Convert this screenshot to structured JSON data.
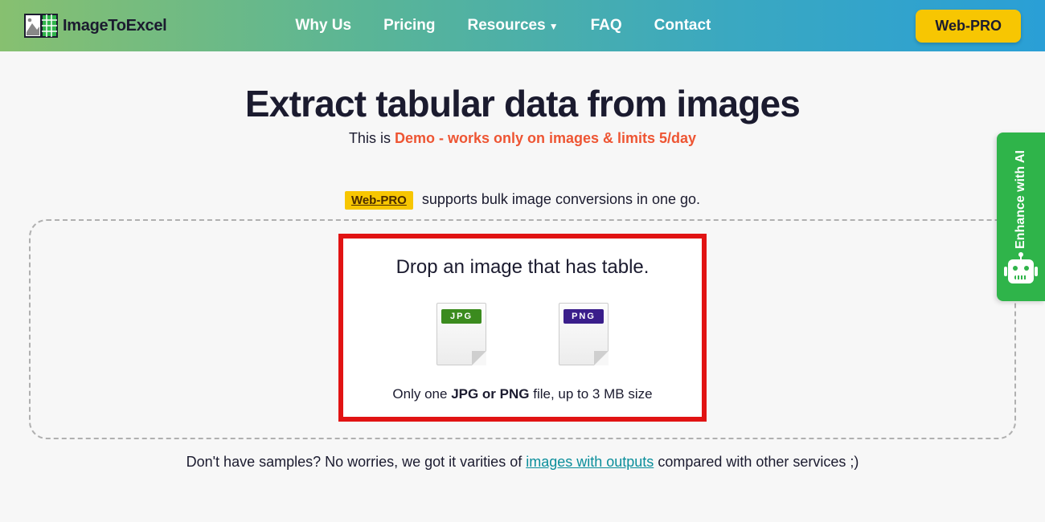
{
  "nav": {
    "brand": "ImageToExcel",
    "links": {
      "why": "Why Us",
      "pricing": "Pricing",
      "resources": "Resources",
      "faq": "FAQ",
      "contact": "Contact"
    },
    "cta": "Web-PRO"
  },
  "hero": {
    "title": "Extract tabular data from images",
    "subtitle_prefix": "This is ",
    "subtitle_demo": "Demo - works only on images & limits 5/day"
  },
  "proline": {
    "badge": "Web-PRO",
    "text": " supports bulk image conversions in one go."
  },
  "dropzone": {
    "title": "Drop an image that has table.",
    "jpg_label": "JPG",
    "png_label": "PNG",
    "note_pre": "Only one ",
    "note_bold": "JPG or PNG",
    "note_post": " file, up to 3 MB size"
  },
  "samples": {
    "pre": "Don't have samples? No worries, we got it varities of ",
    "link": "images with outputs",
    "post": " compared with other services ;)"
  },
  "sidebar": {
    "enhance": "Enhance with AI"
  }
}
